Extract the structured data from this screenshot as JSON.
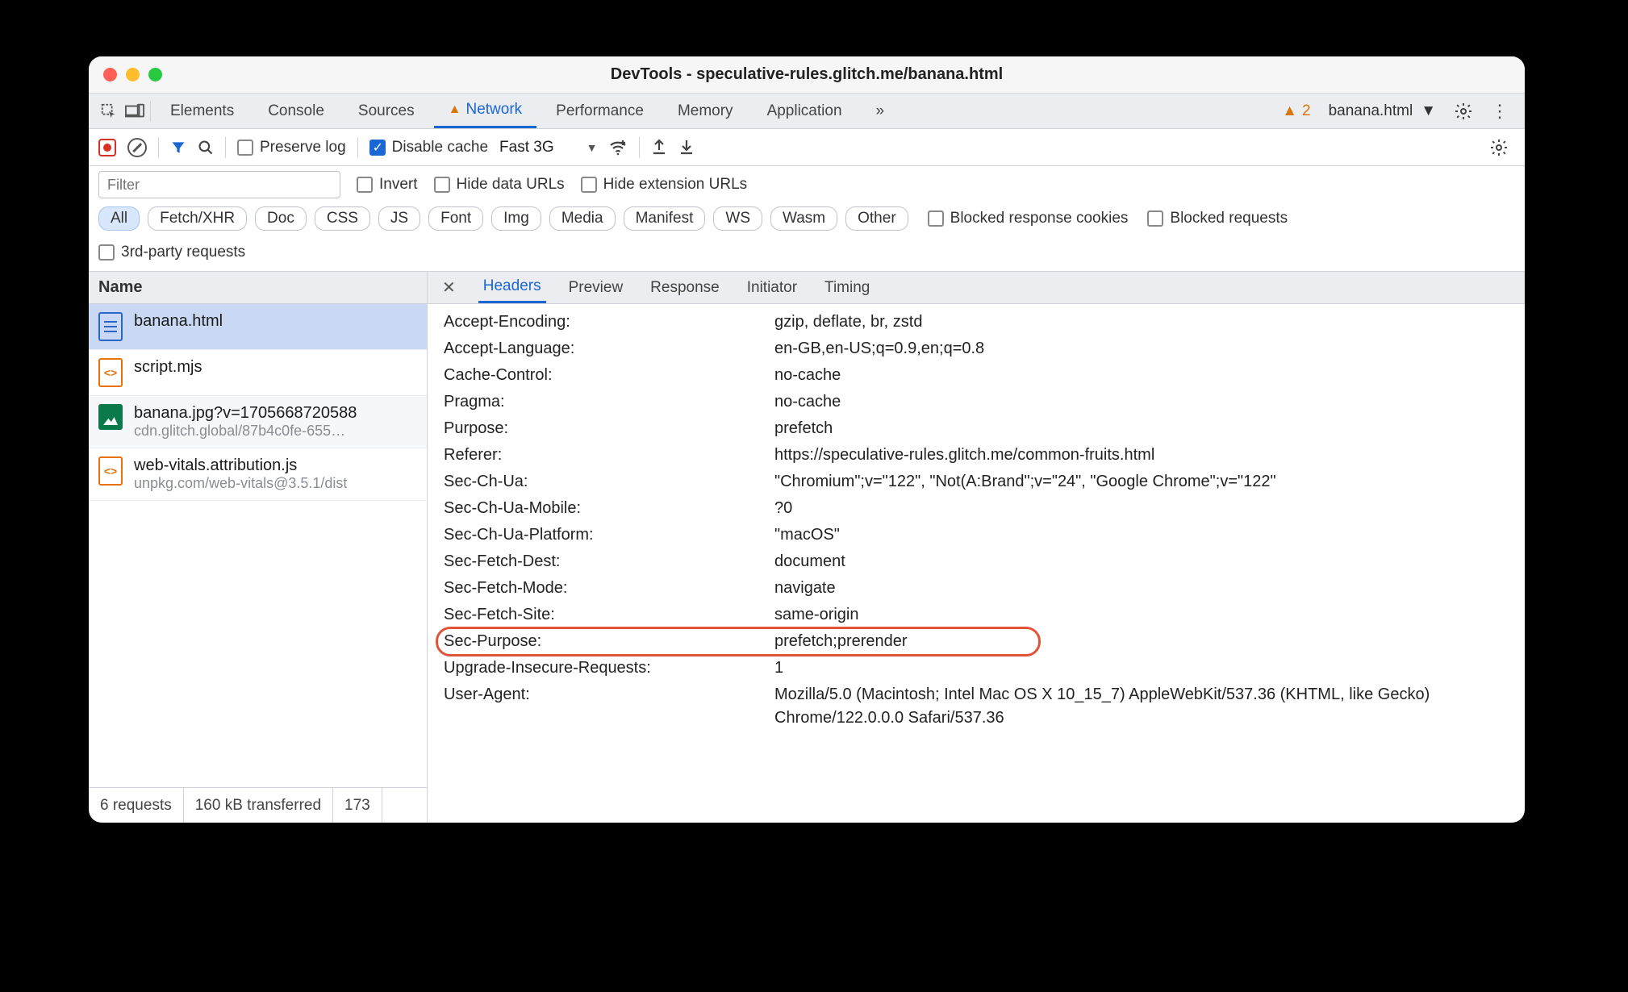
{
  "window": {
    "title": "DevTools - speculative-rules.glitch.me/banana.html"
  },
  "tabs": {
    "items": [
      "Elements",
      "Console",
      "Sources",
      "Network",
      "Performance",
      "Memory",
      "Application"
    ],
    "active": "Network",
    "warn_on": "Network",
    "overflow_icon": "»",
    "warnings_count": "2",
    "context_label": "banana.html"
  },
  "nettools": {
    "preserve_log": "Preserve log",
    "disable_cache": "Disable cache",
    "throttle": "Fast 3G"
  },
  "filters": {
    "placeholder": "Filter",
    "invert": "Invert",
    "hide_data_urls": "Hide data URLs",
    "hide_ext_urls": "Hide extension URLs",
    "chips": [
      "All",
      "Fetch/XHR",
      "Doc",
      "CSS",
      "JS",
      "Font",
      "Img",
      "Media",
      "Manifest",
      "WS",
      "Wasm",
      "Other"
    ],
    "chip_active": "All",
    "blocked_cookies": "Blocked response cookies",
    "blocked_requests": "Blocked requests",
    "third_party": "3rd-party requests"
  },
  "left": {
    "col_name": "Name",
    "requests": [
      {
        "icon": "doc",
        "name": "banana.html",
        "sub": "",
        "selected": true
      },
      {
        "icon": "js",
        "name": "script.mjs",
        "sub": ""
      },
      {
        "icon": "img",
        "name": "banana.jpg?v=1705668720588",
        "sub": "cdn.glitch.global/87b4c0fe-655…",
        "alt": true
      },
      {
        "icon": "js",
        "name": "web-vitals.attribution.js",
        "sub": "unpkg.com/web-vitals@3.5.1/dist"
      }
    ],
    "status": {
      "requests": "6 requests",
      "transferred": "160 kB transferred",
      "resources": "173"
    }
  },
  "right": {
    "subtabs": [
      "Headers",
      "Preview",
      "Response",
      "Initiator",
      "Timing"
    ],
    "active": "Headers",
    "headers": [
      {
        "k": "Accept-Encoding:",
        "v": "gzip, deflate, br, zstd"
      },
      {
        "k": "Accept-Language:",
        "v": "en-GB,en-US;q=0.9,en;q=0.8"
      },
      {
        "k": "Cache-Control:",
        "v": "no-cache"
      },
      {
        "k": "Pragma:",
        "v": "no-cache"
      },
      {
        "k": "Purpose:",
        "v": "prefetch"
      },
      {
        "k": "Referer:",
        "v": "https://speculative-rules.glitch.me/common-fruits.html"
      },
      {
        "k": "Sec-Ch-Ua:",
        "v": "\"Chromium\";v=\"122\", \"Not(A:Brand\";v=\"24\", \"Google Chrome\";v=\"122\""
      },
      {
        "k": "Sec-Ch-Ua-Mobile:",
        "v": "?0"
      },
      {
        "k": "Sec-Ch-Ua-Platform:",
        "v": "\"macOS\""
      },
      {
        "k": "Sec-Fetch-Dest:",
        "v": "document"
      },
      {
        "k": "Sec-Fetch-Mode:",
        "v": "navigate"
      },
      {
        "k": "Sec-Fetch-Site:",
        "v": "same-origin"
      },
      {
        "k": "Sec-Purpose:",
        "v": "prefetch;prerender",
        "highlight": true
      },
      {
        "k": "Upgrade-Insecure-Requests:",
        "v": "1"
      },
      {
        "k": "User-Agent:",
        "v": "Mozilla/5.0 (Macintosh; Intel Mac OS X 10_15_7) AppleWebKit/537.36 (KHTML, like Gecko) Chrome/122.0.0.0 Safari/537.36"
      }
    ]
  }
}
